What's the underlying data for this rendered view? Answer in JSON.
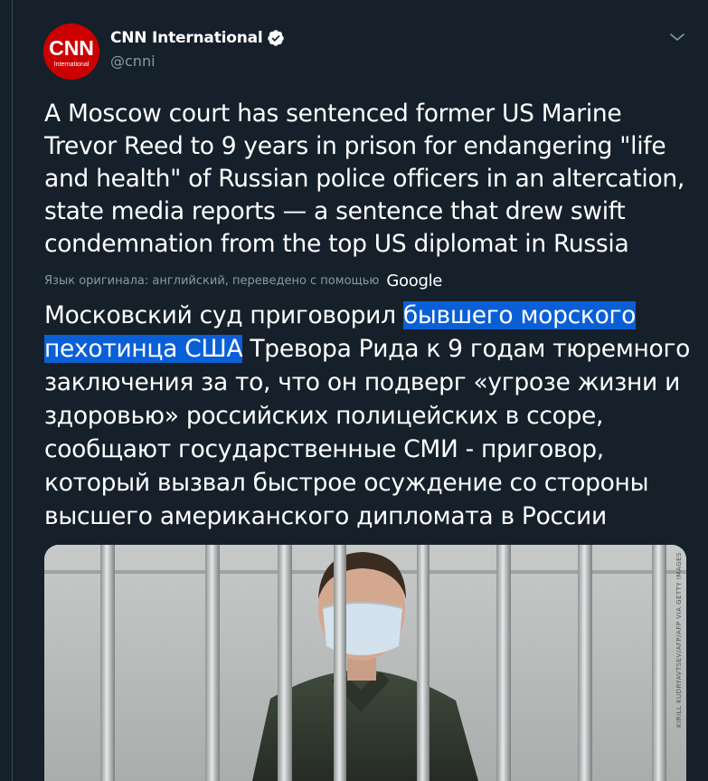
{
  "account": {
    "name": "CNN International",
    "handle": "@cnni",
    "avatar_icon": "cnn-international-logo",
    "avatar_logo_text": "CNN",
    "avatar_sub_text": "International",
    "verified_icon": "verified-badge-icon",
    "menu_icon": "chevron-down-icon"
  },
  "tweet": {
    "original_text": "A Moscow court has sentenced former US Marine Trevor Reed to 9 years in prison for endangering \"life and health\" of Russian police officers in an altercation, state media reports — a sentence that drew swift condemnation from the top US diplomat in Russia",
    "translation_note": "Язык оригинала: английский, переведено с помощью",
    "translation_provider": "Google",
    "translated_before": "Московский суд приговорил ",
    "translated_highlight_1": "бывшего морского ",
    "translated_highlight_2": "пехотинца США",
    "translated_after": " Тревора Рида к 9 годам тюремного заключения за то, что он подверг «угрозе жизни и здоровью» российских полицейских в ссоре, сообщают государственные СМИ - приговор, который вызвал быстрое осуждение со стороны высшего американского дипломата в России",
    "highlight_color": "#0a5fd6"
  },
  "media": {
    "type": "photo",
    "credit": "KIRILL KUDRYAVTSEV/AFP/AFP VIA GETTY IMAGES",
    "icon": "photo-man-behind-bars"
  },
  "colors": {
    "background": "#15202b",
    "border": "#38444d",
    "secondary_text": "#8899a6",
    "brand": "#cc0000",
    "verified": "#ffffff"
  }
}
